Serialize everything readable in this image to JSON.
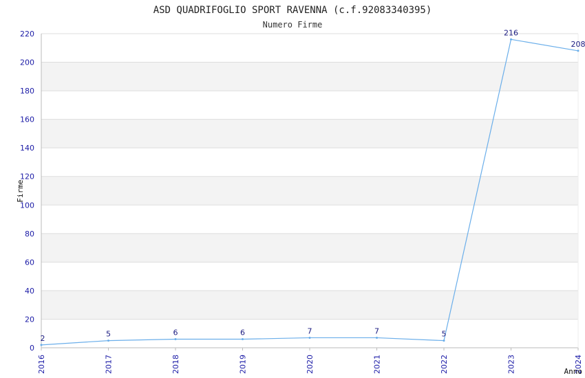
{
  "colors": {
    "line": "#6aaeea",
    "tick_text": "#1a1aa6",
    "data_label": "#1a1a80",
    "band": "#f3f3f3",
    "grid": "#dddddd",
    "axis": "#bbbbbb"
  },
  "chart_data": {
    "type": "line",
    "title": "ASD QUADRIFOGLIO SPORT RAVENNA (c.f.92083340395)",
    "subtitle": "Numero Firme",
    "xlabel": "Anno",
    "ylabel": "Firme",
    "categories": [
      "2016",
      "2017",
      "2018",
      "2019",
      "2020",
      "2021",
      "2022",
      "2023",
      "2024"
    ],
    "series": [
      {
        "values": [
          2,
          5,
          6,
          6,
          7,
          7,
          5,
          216,
          208
        ]
      }
    ],
    "ylim": [
      0,
      220
    ],
    "yticks": [
      0,
      20,
      40,
      60,
      80,
      100,
      120,
      140,
      160,
      180,
      200,
      220
    ],
    "grid": true,
    "data_labels": true
  }
}
